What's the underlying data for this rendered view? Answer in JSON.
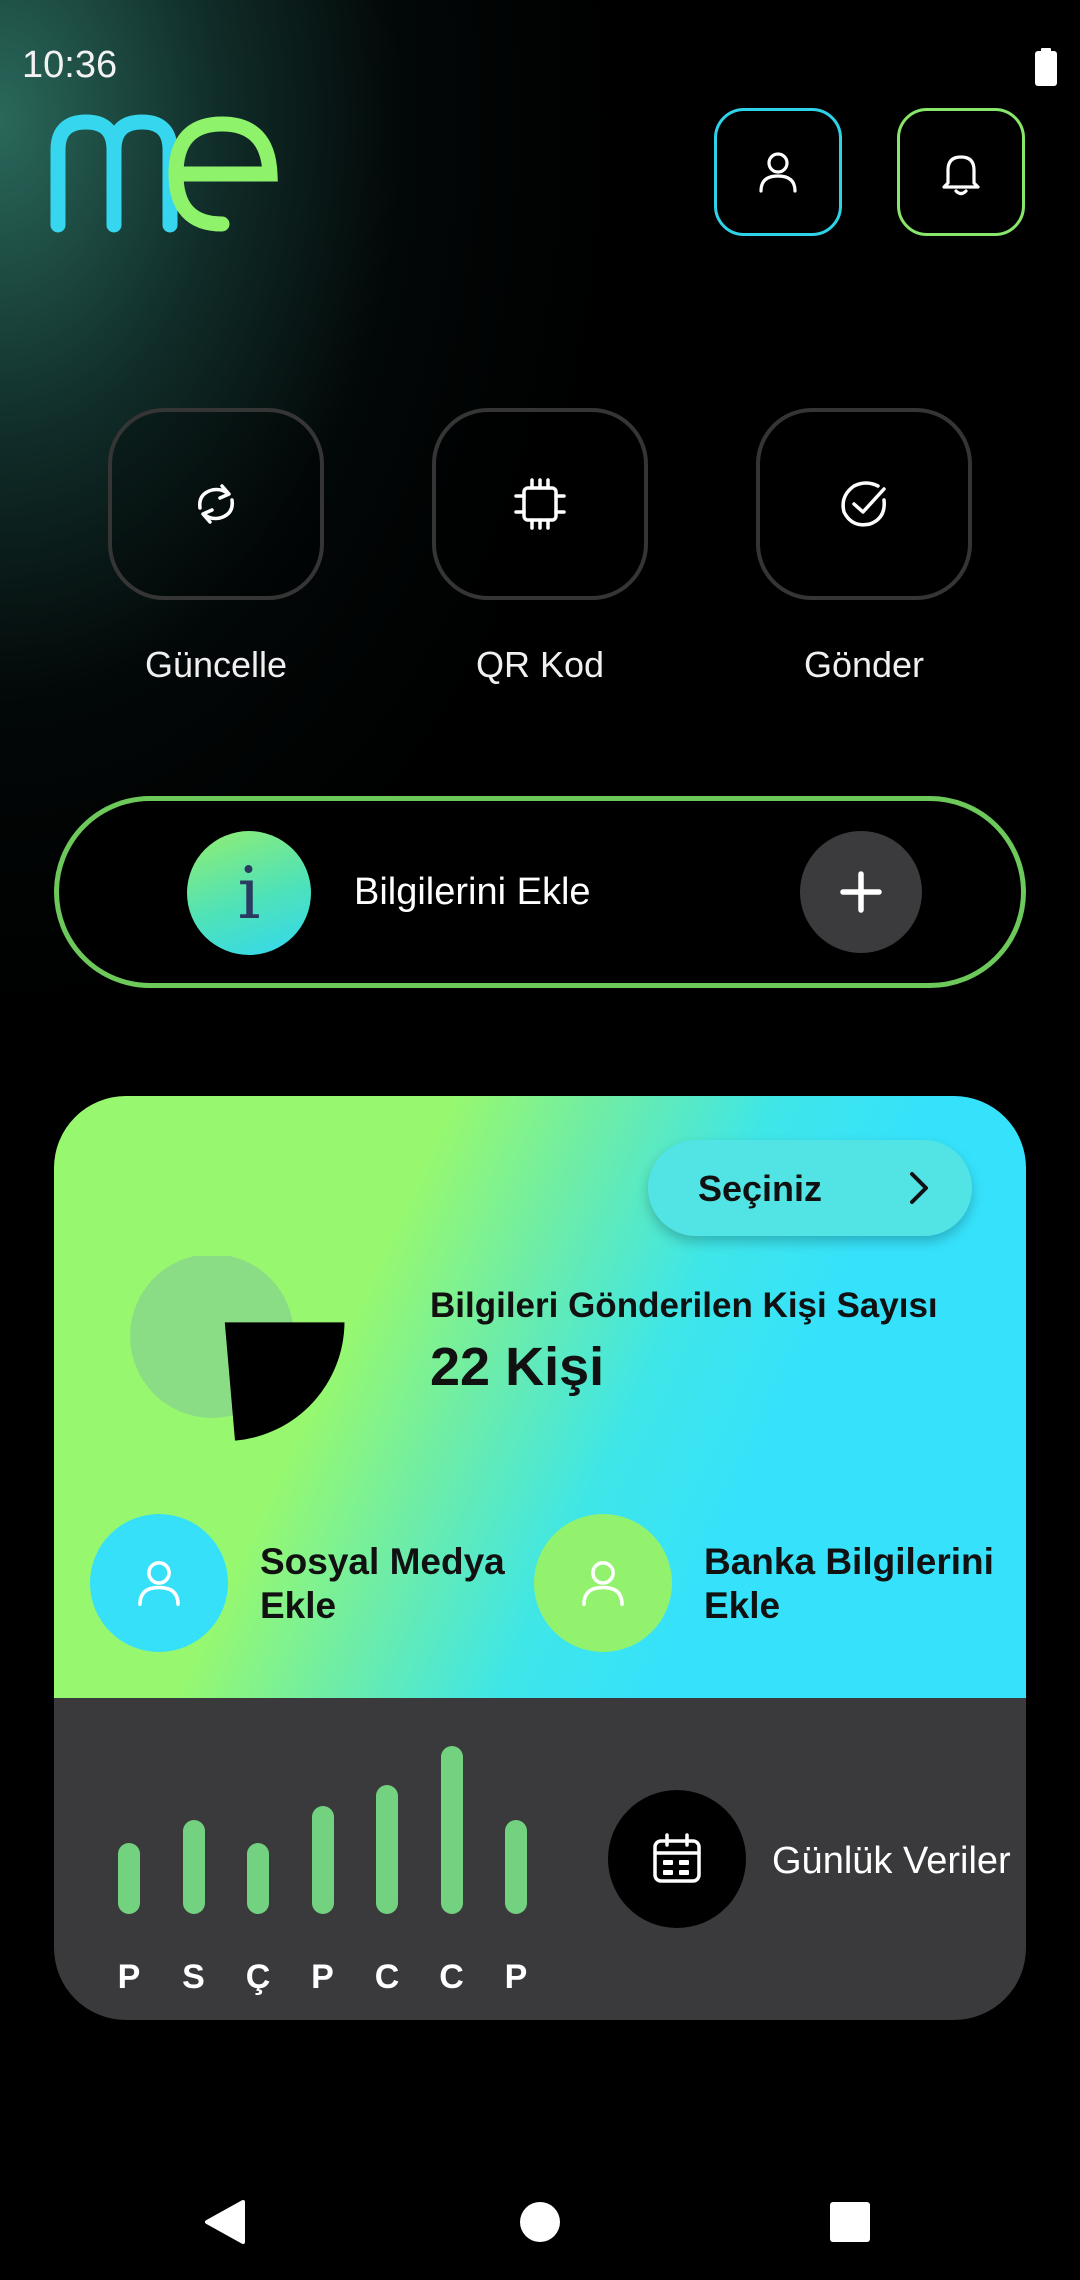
{
  "status_bar": {
    "time": "10:36",
    "battery_icon": "battery-icon"
  },
  "header": {
    "logo_icon": "me-logo",
    "profile_icon": "user-icon",
    "notifications_icon": "bell-icon",
    "colors": {
      "cyan": "#2fd3e8",
      "green": "#88e66a"
    }
  },
  "actions": [
    {
      "label": "Güncelle",
      "icon": "refresh-icon"
    },
    {
      "label": "QR Kod",
      "icon": "chip-icon"
    },
    {
      "label": "Gönder",
      "icon": "check-circle-icon"
    }
  ],
  "info_banner": {
    "icon_glyph": "i",
    "label": "Bilgilerini Ekle",
    "add_icon": "plus-icon"
  },
  "stats": {
    "select_label": "Seçiniz",
    "title": "Bilgileri Gönderilen Kişi Sayısı",
    "value": "22 Kişi",
    "quick_add": [
      {
        "line1": "Sosyal Medya",
        "line2": "Ekle",
        "icon": "user-icon"
      },
      {
        "line1": "Banka Bilgilerini",
        "line2": "Ekle",
        "icon": "user-icon"
      }
    ],
    "weekly": {
      "days": [
        "P",
        "S",
        "Ç",
        "P",
        "C",
        "C",
        "P"
      ],
      "values": [
        0.42,
        0.56,
        0.42,
        0.64,
        0.77,
        1.0,
        0.56
      ]
    },
    "daily_label": "Günlük Veriler",
    "calendar_icon": "calendar-icon",
    "colors": {
      "green": "#97f86f",
      "cyan": "#36e2fb",
      "bar": "#72d27f"
    }
  },
  "nav": {
    "back_icon": "back-icon",
    "home_icon": "home-icon",
    "recent_icon": "recent-apps-icon"
  }
}
